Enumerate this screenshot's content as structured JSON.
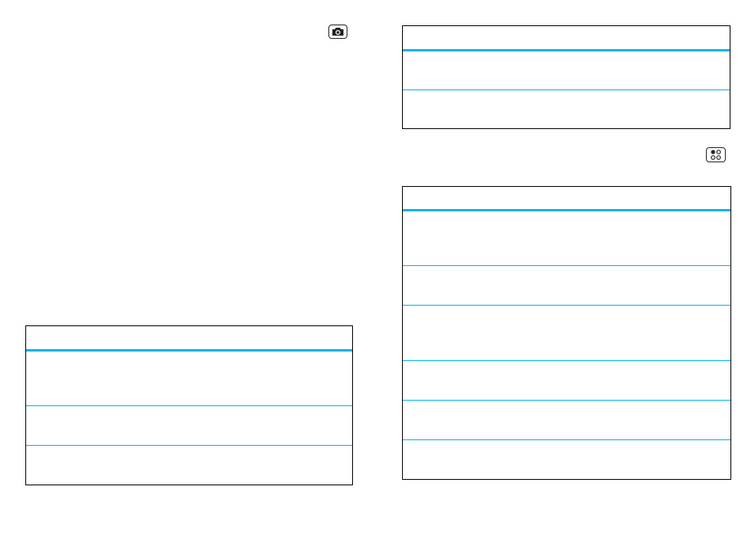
{
  "page": {
    "left": {
      "icon": "camera-icon",
      "table": {
        "header": "",
        "rows": [
          "",
          "",
          ""
        ]
      }
    },
    "right": {
      "icon": "menu-grid-icon",
      "table_top": {
        "header": "",
        "rows": [
          "",
          ""
        ]
      },
      "table_bottom": {
        "header": "",
        "rows": [
          "",
          "",
          "",
          "",
          "",
          ""
        ]
      }
    }
  },
  "colors": {
    "accent": "#00b4f0",
    "border": "#000000"
  }
}
